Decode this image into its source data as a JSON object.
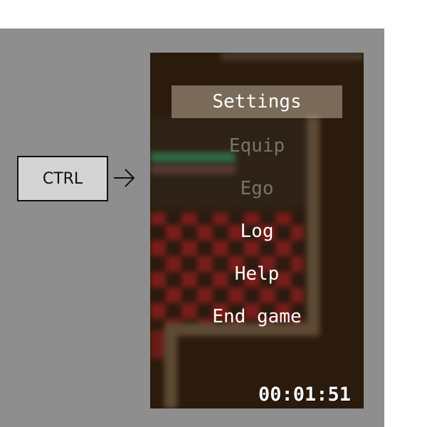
{
  "keyboard_hint": {
    "key_label": "CTRL",
    "arrow_icon": "arrow-right-icon"
  },
  "menu": {
    "items": [
      {
        "label": "Settings",
        "state": "selected"
      },
      {
        "label": "Equip",
        "state": "disabled"
      },
      {
        "label": "Ego",
        "state": "disabled"
      },
      {
        "label": "Log",
        "state": "enabled"
      },
      {
        "label": "Help",
        "state": "enabled"
      },
      {
        "label": "End game",
        "state": "enabled"
      }
    ]
  },
  "timer": "00:01:51",
  "colors": {
    "stage_background": "#8e8e8e",
    "game_background": "#2a1a0a",
    "selected_highlight": "#dccdb9",
    "disabled_text": "#7a736a"
  }
}
